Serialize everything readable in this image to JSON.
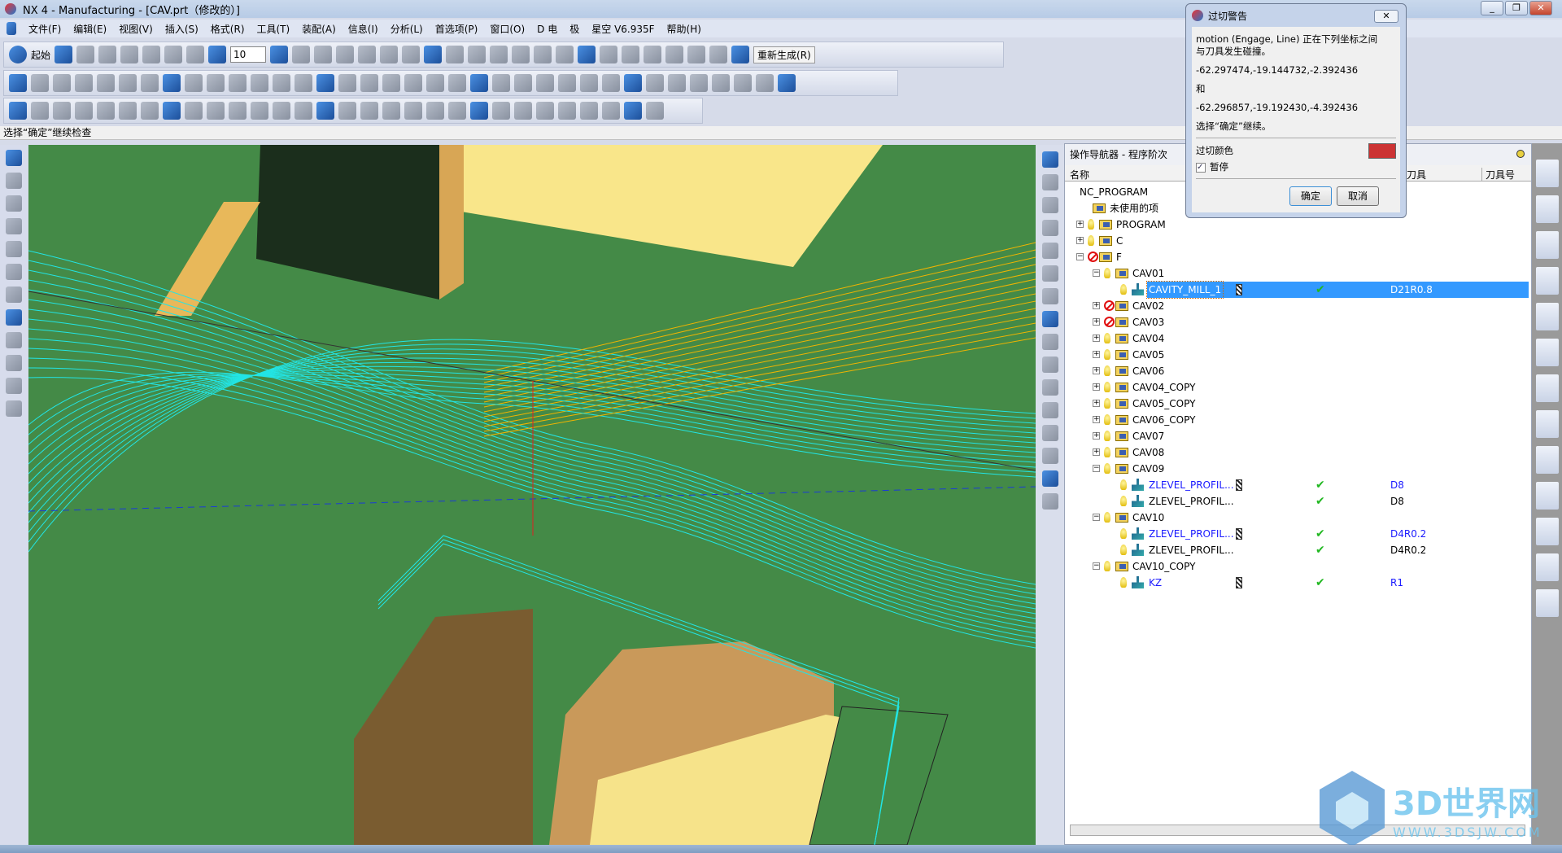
{
  "window": {
    "title": "NX 4 - Manufacturing - [CAV.prt（修改的）]"
  },
  "menu": [
    "文件(F)",
    "编辑(E)",
    "视图(V)",
    "插入(S)",
    "格式(R)",
    "工具(T)",
    "装配(A)",
    "信息(I)",
    "分析(L)",
    "首选项(P)",
    "窗口(O)",
    "D 电",
    "极",
    "星空 V6.935F",
    "帮助(H)"
  ],
  "toolbar": {
    "start_label": "起始",
    "layer_value": "10",
    "regenerate_label": "重新生成(R)"
  },
  "status": {
    "prompt": "选择“确定”继续检查"
  },
  "navigator": {
    "title": "操作导航器 - 程序阶次",
    "columns": [
      "名称",
      "刀具",
      "刀具号"
    ],
    "rows": [
      {
        "name": "NC_PROGRAM",
        "level": 0
      },
      {
        "name": "未使用的项",
        "level": 1,
        "type": "folder"
      },
      {
        "name": "PROGRAM",
        "level": 1,
        "exp": "+",
        "status": "bulb",
        "type": "folder"
      },
      {
        "name": "C",
        "level": 1,
        "exp": "+",
        "status": "bulb",
        "type": "folder"
      },
      {
        "name": "F",
        "level": 1,
        "exp": "-",
        "status": "no",
        "type": "folder"
      },
      {
        "name": "CAV01",
        "level": 2,
        "exp": "-",
        "status": "bulb",
        "type": "folder"
      },
      {
        "name": "CAVITY_MILL_1",
        "level": 3,
        "status": "bulb",
        "type": "op",
        "selected": true,
        "path": true,
        "check": true,
        "tool": "D21R0.8"
      },
      {
        "name": "CAV02",
        "level": 2,
        "exp": "+",
        "status": "no",
        "type": "folder"
      },
      {
        "name": "CAV03",
        "level": 2,
        "exp": "+",
        "status": "no",
        "type": "folder"
      },
      {
        "name": "CAV04",
        "level": 2,
        "exp": "+",
        "status": "bulb",
        "type": "folder"
      },
      {
        "name": "CAV05",
        "level": 2,
        "exp": "+",
        "status": "bulb",
        "type": "folder"
      },
      {
        "name": "CAV06",
        "level": 2,
        "exp": "+",
        "status": "bulb",
        "type": "folder"
      },
      {
        "name": "CAV04_COPY",
        "level": 2,
        "exp": "+",
        "status": "bulb",
        "type": "folder"
      },
      {
        "name": "CAV05_COPY",
        "level": 2,
        "exp": "+",
        "status": "bulb",
        "type": "folder"
      },
      {
        "name": "CAV06_COPY",
        "level": 2,
        "exp": "+",
        "status": "bulb",
        "type": "folder"
      },
      {
        "name": "CAV07",
        "level": 2,
        "exp": "+",
        "status": "bulb",
        "type": "folder"
      },
      {
        "name": "CAV08",
        "level": 2,
        "exp": "+",
        "status": "bulb",
        "type": "folder"
      },
      {
        "name": "CAV09",
        "level": 2,
        "exp": "-",
        "status": "bulb",
        "type": "folder"
      },
      {
        "name": "ZLEVEL_PROFIL...",
        "level": 3,
        "status": "bulb",
        "type": "op",
        "blue": true,
        "path": true,
        "check": true,
        "tool": "D8"
      },
      {
        "name": "ZLEVEL_PROFIL...",
        "level": 3,
        "status": "bulb",
        "type": "op",
        "check": true,
        "tool": "D8"
      },
      {
        "name": "CAV10",
        "level": 2,
        "exp": "-",
        "status": "bulb",
        "type": "folder"
      },
      {
        "name": "ZLEVEL_PROFIL...",
        "level": 3,
        "status": "bulb",
        "type": "op",
        "blue": true,
        "path": true,
        "check": true,
        "tool": "D4R0.2"
      },
      {
        "name": "ZLEVEL_PROFIL...",
        "level": 3,
        "status": "bulb",
        "type": "op",
        "check": true,
        "tool": "D4R0.2"
      },
      {
        "name": "CAV10_COPY",
        "level": 2,
        "exp": "-",
        "status": "bulb",
        "type": "folder"
      },
      {
        "name": "KZ",
        "level": 3,
        "status": "bulb",
        "type": "op",
        "blue": true,
        "path": true,
        "check": true,
        "tool": "R1"
      }
    ]
  },
  "dialog": {
    "title": "过切警告",
    "message": "motion (Engage, Line) 正在下列坐标之间与刀具发生碰撞。",
    "point1": "-62.297474,-19.144732,-2.392436",
    "and": "和",
    "point2": " -62.296857,-19.192430,-4.392436",
    "instruction": "选择“确定”继续。",
    "gouge_color_label": "过切颜色",
    "gouge_color": "#cc3333",
    "pause_label": "暂停",
    "pause_checked": true,
    "ok_label": "确定",
    "cancel_label": "取消"
  },
  "watermark": {
    "text": "3D世界网",
    "url_text": "WWW.3DSJW.COM"
  },
  "colors": {
    "viewport_bg": "#448a47",
    "toolpath": "#22e5e5",
    "selection": "#3399ff"
  }
}
